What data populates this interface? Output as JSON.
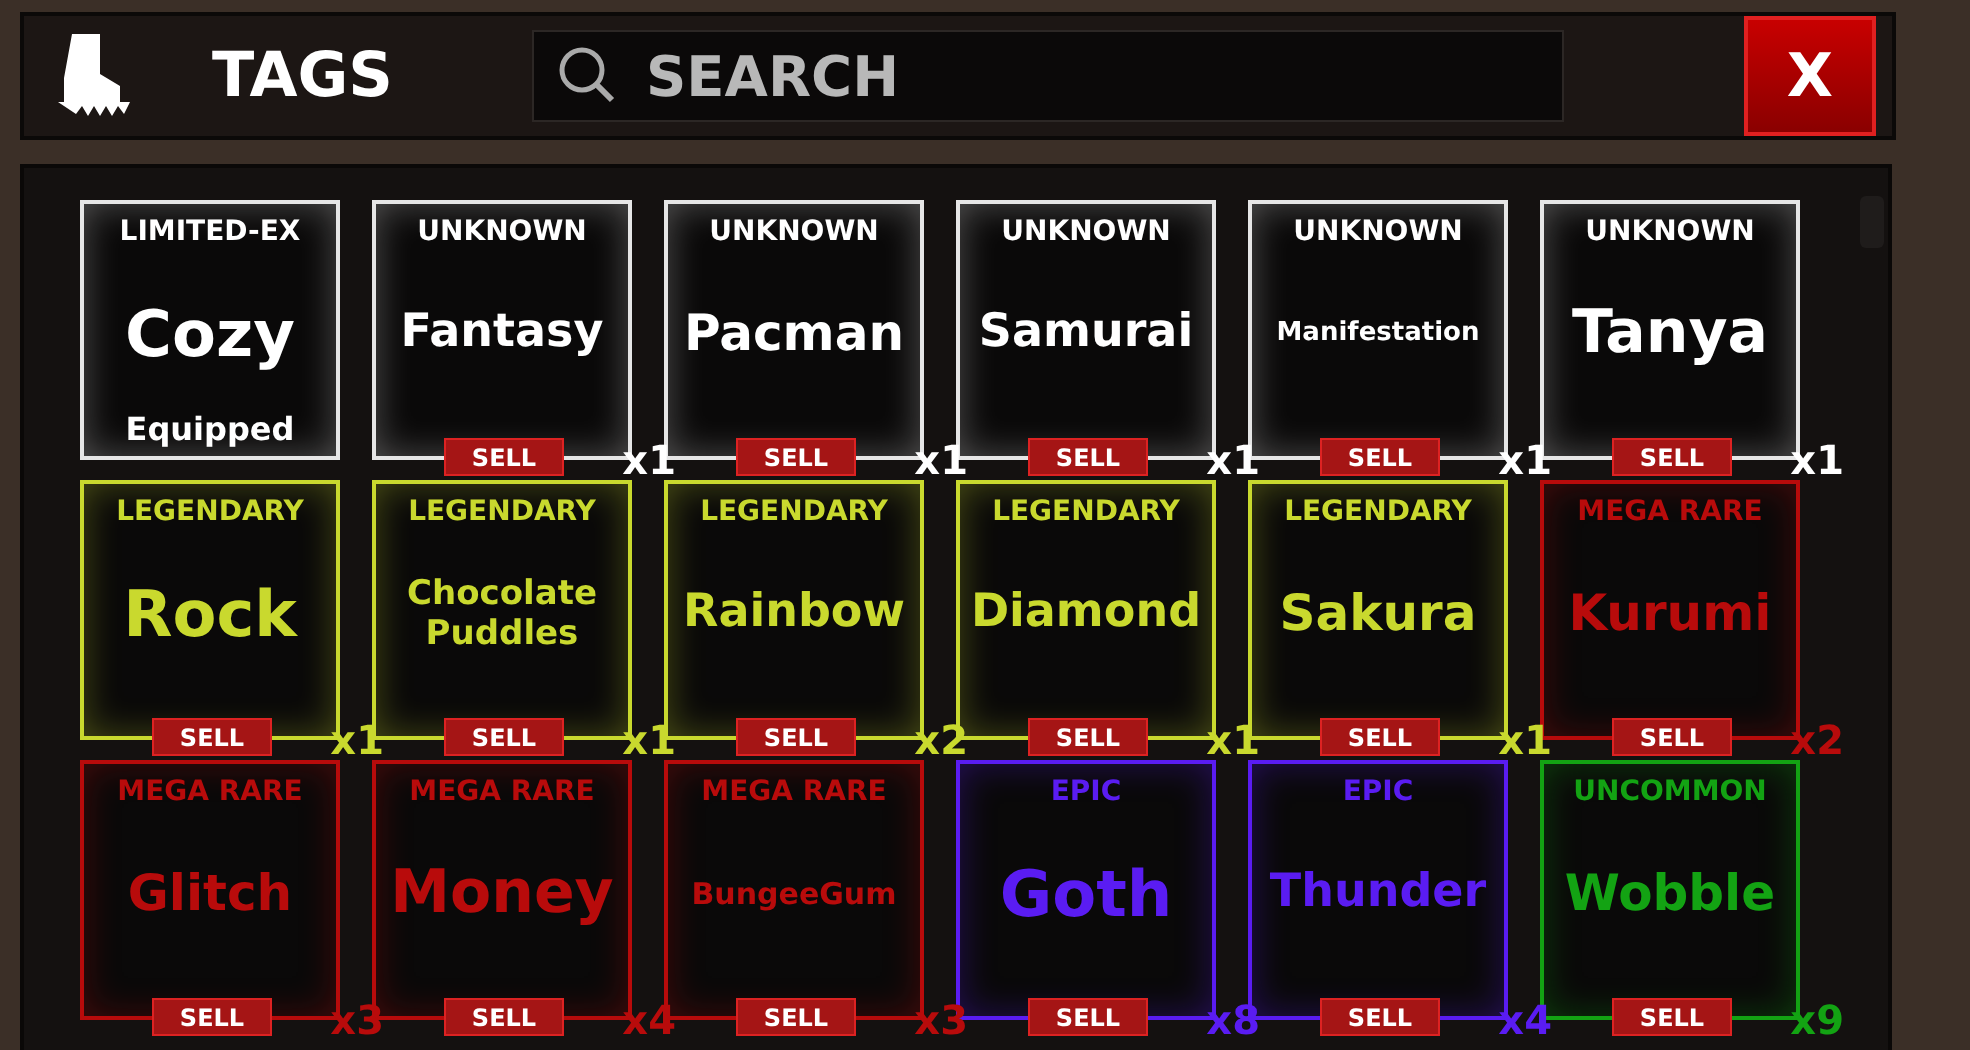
{
  "header": {
    "title": "TAGS",
    "search": {
      "placeholder": "SEARCH"
    },
    "close_label": "X"
  },
  "tags": [
    {
      "rarity": "LIMITED-EX",
      "name": "Cozy",
      "color": "#e6e6e6",
      "equipped": true,
      "equipped_label": "Equipped"
    },
    {
      "rarity": "UNKNOWN",
      "name": "Fantasy",
      "color": "#e6e6e6",
      "equipped": false,
      "sell": "SELL",
      "count": "x1"
    },
    {
      "rarity": "UNKNOWN",
      "name": "Pacman",
      "color": "#e6e6e6",
      "equipped": false,
      "sell": "SELL",
      "count": "x1"
    },
    {
      "rarity": "UNKNOWN",
      "name": "Samurai",
      "color": "#e6e6e6",
      "equipped": false,
      "sell": "SELL",
      "count": "x1"
    },
    {
      "rarity": "UNKNOWN",
      "name": "Manifestation",
      "color": "#e6e6e6",
      "equipped": false,
      "sell": "SELL",
      "count": "x1"
    },
    {
      "rarity": "UNKNOWN",
      "name": "Tanya",
      "color": "#e6e6e6",
      "equipped": false,
      "sell": "SELL",
      "count": "x1"
    },
    {
      "rarity": "LEGENDARY",
      "name": "Rock",
      "color": "#c9d92e",
      "equipped": false,
      "sell": "SELL",
      "count": "x1"
    },
    {
      "rarity": "LEGENDARY",
      "name": "Chocolate Puddles",
      "color": "#c9d92e",
      "equipped": false,
      "sell": "SELL",
      "count": "x1"
    },
    {
      "rarity": "LEGENDARY",
      "name": "Rainbow",
      "color": "#c9d92e",
      "equipped": false,
      "sell": "SELL",
      "count": "x2"
    },
    {
      "rarity": "LEGENDARY",
      "name": "Diamond",
      "color": "#c9d92e",
      "equipped": false,
      "sell": "SELL",
      "count": "x1"
    },
    {
      "rarity": "LEGENDARY",
      "name": "Sakura",
      "color": "#c9d92e",
      "equipped": false,
      "sell": "SELL",
      "count": "x1"
    },
    {
      "rarity": "MEGA RARE",
      "name": "Kurumi",
      "color": "#b80b0b",
      "equipped": false,
      "sell": "SELL",
      "count": "x2"
    },
    {
      "rarity": "MEGA RARE",
      "name": "Glitch",
      "color": "#b80b0b",
      "equipped": false,
      "sell": "SELL",
      "count": "x3"
    },
    {
      "rarity": "MEGA RARE",
      "name": "Money",
      "color": "#b80b0b",
      "equipped": false,
      "sell": "SELL",
      "count": "x4"
    },
    {
      "rarity": "MEGA RARE",
      "name": "BungeeGum",
      "color": "#b80b0b",
      "equipped": false,
      "sell": "SELL",
      "count": "x3"
    },
    {
      "rarity": "EPIC",
      "name": "Goth",
      "color": "#5a1cf2",
      "equipped": false,
      "sell": "SELL",
      "count": "x8"
    },
    {
      "rarity": "EPIC",
      "name": "Thunder",
      "color": "#5a1cf2",
      "equipped": false,
      "sell": "SELL",
      "count": "x4"
    },
    {
      "rarity": "UNCOMMON",
      "name": "Wobble",
      "color": "#13a313",
      "equipped": false,
      "sell": "SELL",
      "count": "x9"
    }
  ]
}
